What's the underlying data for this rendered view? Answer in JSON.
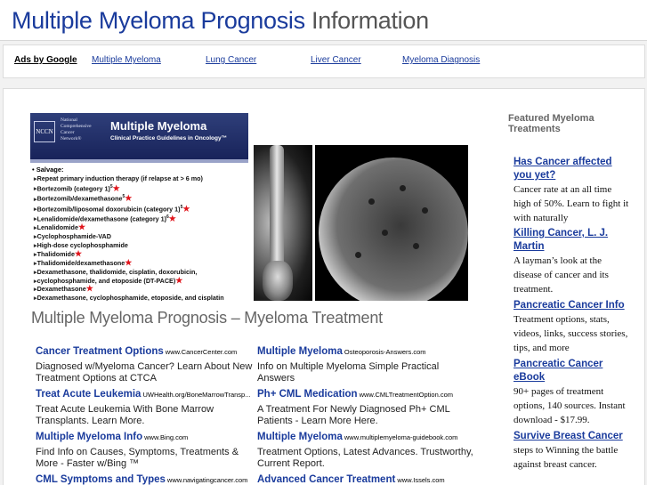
{
  "header": {
    "title_main": "Multiple Myeloma Prognosis",
    "title_suffix": "Information"
  },
  "adbar": {
    "ads_by": "Ads by Google",
    "links": [
      "Multiple Myeloma",
      "Lung Cancer",
      "Liver Cancer",
      "Myeloma Diagnosis"
    ]
  },
  "slide": {
    "logo": "NCCN",
    "org_text": "National\nComprehensive\nCancer\nNetwork®",
    "title": "Multiple Myeloma",
    "subtitle": "Clinical Practice Guidelines in Oncology™",
    "section": "• Salvage:",
    "items": [
      {
        "text": "Repeat primary induction therapy (if relapse at > 6 mo)",
        "sup": "",
        "star": false
      },
      {
        "text": "Bortezomib (category 1)",
        "sup": "5",
        "star": true
      },
      {
        "text": "Bortezomib/dexamethasone",
        "sup": "5",
        "star": true
      },
      {
        "text": "Bortezomib/liposomal doxorubicin (category 1)",
        "sup": "5",
        "star": true
      },
      {
        "text": "Lenalidomide/dexamethasone (category 1)",
        "sup": "6",
        "star": true
      },
      {
        "text": "Lenalidomide",
        "sup": "",
        "star": true
      },
      {
        "text": "Cyclophosphamide-VAD",
        "sup": "",
        "star": false
      },
      {
        "text": "High-dose cyclophosphamide",
        "sup": "",
        "star": false
      },
      {
        "text": "Thalidomide",
        "sup": "",
        "star": true
      },
      {
        "text": "Thalidomide/dexamethasone",
        "sup": "",
        "star": true
      },
      {
        "text": "Dexamethasone, thalidomide, cisplatin, doxorubicin,",
        "sup": "",
        "star": false
      },
      {
        "text": "cyclophosphamide, and etoposide (DT-PACE)",
        "sup": "",
        "star": true
      },
      {
        "text": "Dexamethasone",
        "sup": "",
        "star": true
      },
      {
        "text": "Dexamethasone, cyclophosphamide, etoposide, and cisplatin",
        "sup": "",
        "star": false
      }
    ]
  },
  "article": {
    "title": "Multiple Myeloma Prognosis – Myeloma Treatment"
  },
  "ads": [
    {
      "title": "Cancer Treatment Options",
      "url": "www.CancerCenter.com",
      "desc": "Diagnosed w/Myeloma Cancer? Learn About New Treatment Options at CTCA"
    },
    {
      "title": "Multiple Myeloma",
      "url": "Osteoporosis-Answers.com",
      "desc": "Info on Multiple Myeloma Simple Practical Answers"
    },
    {
      "title": "Treat Acute Leukemia",
      "url": "UWHealth.org/BoneMarrowTransp...",
      "desc": "Treat Acute Leukemia With Bone Marrow Transplants. Learn More."
    },
    {
      "title": "Ph+ CML Medication",
      "url": "www.CMLTreatmentOption.com",
      "desc": "A Treatment For Newly Diagnosed Ph+ CML Patients - Learn More Here."
    },
    {
      "title": "Multiple Myeloma Info",
      "url": "www.Bing.com",
      "desc": "Find Info on Causes, Symptoms, Treatments & More - Faster w/Bing ™"
    },
    {
      "title": "Multiple Myeloma",
      "url": "www.multiplemyeloma-guidebook.com",
      "desc": "Treatment Options, Latest Advances. Trustworthy, Current Report."
    },
    {
      "title": "CML Symptoms and Types",
      "url": "www.navigatingcancer.com",
      "desc": ""
    },
    {
      "title": "Advanced Cancer Treatment",
      "url": "www.Issels.com",
      "desc": ""
    }
  ],
  "sidebar": {
    "heading": "Featured Myeloma Treatments",
    "items": [
      {
        "title": "Has Cancer affected you yet?",
        "desc": "Cancer rate at an all time high of 50%. Learn to fight it with naturally"
      },
      {
        "title": "Killing Cancer, L. J. Martin",
        "desc": "A layman’s look at the disease of cancer and its treatment."
      },
      {
        "title": "Pancreatic Cancer Info",
        "desc": "Treatment options, stats, videos, links, success stories, tips, and more"
      },
      {
        "title": "Pancreatic Cancer eBook",
        "desc": "90+ pages of treatment options, 140 sources. Instant download - $17.99."
      },
      {
        "title": "Survive Breast Cancer",
        "desc": "steps to Winning the battle against breast cancer."
      }
    ]
  }
}
